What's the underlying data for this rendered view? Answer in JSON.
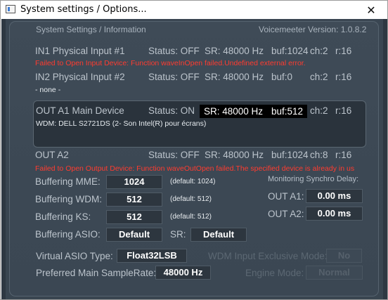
{
  "window": {
    "title": "System settings / Options...",
    "close_glyph": "✕"
  },
  "header": {
    "section_title": "System Settings / Information",
    "version": "Voicemeeter Version: 1.0.8.2"
  },
  "devices": {
    "in1": {
      "name": "IN1 Physical Input #1",
      "status": "Status: OFF",
      "sr": "SR: 48000 Hz",
      "buf": "buf:1024",
      "ch": "ch:2",
      "r": "r:16",
      "detail": "Failed to Open Input Device: Function waveInOpen failed.Undefined external error."
    },
    "in2": {
      "name": "IN2 Physical Input #2",
      "status": "Status: OFF",
      "sr": "SR: 48000 Hz",
      "buf": "buf:0",
      "ch": "ch:2",
      "r": "r:16",
      "detail": "- none -"
    },
    "outA1": {
      "name": "OUT A1 Main Device",
      "status": "Status: ON",
      "sr": "SR: 48000 Hz",
      "buf": "buf:512",
      "ch": "ch:2",
      "r": "r:16",
      "detail": "WDM: DELL S2721DS (2- Son Intel(R) pour écrans)"
    },
    "outA2": {
      "name": "OUT A2",
      "status": "Status: OFF",
      "sr": "SR: 48000 Hz",
      "buf": "buf:1024",
      "ch": "ch:8",
      "r": "r:16",
      "detail": "Failed to Open Output Device: Function waveOutOpen failed.The specified device is already in us"
    }
  },
  "buffering": {
    "mme": {
      "label": "Buffering MME:",
      "value": "1024",
      "default": "(default: 1024)"
    },
    "wdm": {
      "label": "Buffering WDM:",
      "value": "512",
      "default": "(default: 512)"
    },
    "ks": {
      "label": "Buffering KS:",
      "value": "512",
      "default": "(default: 512)"
    },
    "asio": {
      "label": "Buffering ASIO:",
      "value": "Default",
      "sr_label": "SR:",
      "sr_value": "Default"
    }
  },
  "sync_delay": {
    "title": "Monitoring Synchro Delay:",
    "a1_label": "OUT A1:",
    "a1_value": "0.00 ms",
    "a2_label": "OUT A2:",
    "a2_value": "0.00 ms"
  },
  "asio": {
    "type_label": "Virtual ASIO Type:",
    "type_value": "Float32LSB",
    "samplerate_label": "Preferred Main SampleRate:",
    "samplerate_value": "48000 Hz"
  },
  "wdm_exclusive": {
    "label": "WDM Input Exclusive Mode:",
    "value": "No"
  },
  "engine_mode": {
    "label": "Engine Mode:",
    "value": "Normal"
  },
  "colors": {
    "background": "#3c4854",
    "error": "#ff3b2f",
    "label": "#bcc4cc",
    "field": "#2d363f"
  }
}
